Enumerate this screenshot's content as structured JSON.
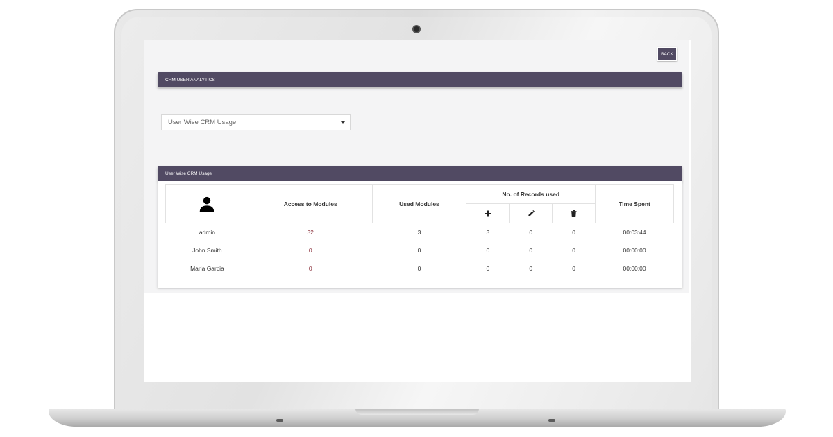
{
  "toolbar": {
    "back_label": "BACK"
  },
  "analytics_panel": {
    "title": "CRM USER ANALYTICS"
  },
  "report_select": {
    "selected": "User Wise CRM Usage"
  },
  "usage_panel": {
    "title": "User Wise CRM Usage",
    "columns": {
      "user_icon": "user-icon",
      "access": "Access to Modules",
      "used": "Used Modules",
      "records": "No. of Records used",
      "records_sub_icons": [
        "plus-icon",
        "pencil-icon",
        "trash-icon"
      ],
      "time": "Time Spent"
    },
    "rows": [
      {
        "name": "admin",
        "access": "32",
        "used": "3",
        "added": "3",
        "edited": "0",
        "deleted": "0",
        "time": "00:03:44"
      },
      {
        "name": "John Smith",
        "access": "0",
        "used": "0",
        "added": "0",
        "edited": "0",
        "deleted": "0",
        "time": "00:00:00"
      },
      {
        "name": "Maria Garcia",
        "access": "0",
        "used": "0",
        "added": "0",
        "edited": "0",
        "deleted": "0",
        "time": "00:00:00"
      }
    ]
  },
  "colors": {
    "header_bg": "#514a63",
    "app_bg": "#f4f4f5",
    "accent_number": "#8a2f3a"
  }
}
